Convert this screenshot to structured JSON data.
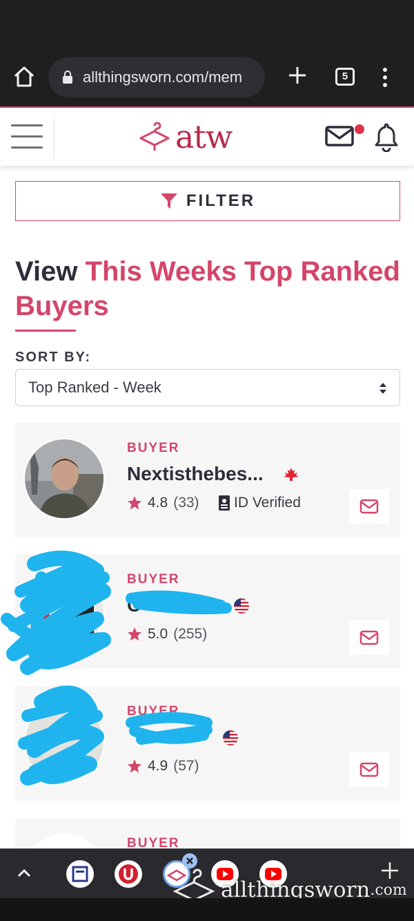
{
  "browser": {
    "url": "allthingsworn.com/mem",
    "tab_count": "5"
  },
  "site": {
    "logo_text": "atw"
  },
  "filter": {
    "label": "FILTER"
  },
  "heading": {
    "part1": "View",
    "part2": "This Weeks Top Ranked Buyers"
  },
  "sort": {
    "label": "SORT BY:",
    "selected": "Top Ranked - Week"
  },
  "buyers": [
    {
      "role": "BUYER",
      "name": "Nextisthebes...",
      "rating": "4.8",
      "reviews": "(33)",
      "verified": "ID Verified",
      "flag": "canada"
    },
    {
      "role": "BUYER",
      "name": "C",
      "rating": "5.0",
      "reviews": "(255)",
      "flag": "usa"
    },
    {
      "role": "BUYER",
      "name": "",
      "rating": "4.9",
      "reviews": "(57)",
      "flag": "usa"
    },
    {
      "role": "BUYER"
    }
  ],
  "watermark": {
    "text": "allthingsworn",
    "suffix": ".com"
  },
  "colors": {
    "accent": "#d4456a",
    "dark_text": "#2e2e3a",
    "card_bg": "#f6f6f7",
    "scribble": "#1fb4ee",
    "browser_bg": "#1f1f1f"
  },
  "icons": [
    "home-icon",
    "lock-icon",
    "plus-icon",
    "tabs-icon",
    "menu-icon",
    "hamburger-icon",
    "envelope-icon",
    "bell-icon",
    "filter-icon",
    "star-icon",
    "id-card-icon",
    "chevron-up-icon"
  ]
}
